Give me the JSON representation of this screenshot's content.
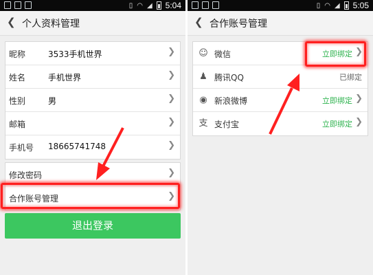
{
  "left_screen": {
    "status": {
      "time": "5:04"
    },
    "title": "个人资料管理",
    "profile_rows": [
      {
        "label": "昵称",
        "value": "3533手机世界"
      },
      {
        "label": "姓名",
        "value": "手机世界"
      },
      {
        "label": "性别",
        "value": "男"
      },
      {
        "label": "邮箱",
        "value": ""
      },
      {
        "label": "手机号",
        "value": "18665741748"
      }
    ],
    "settings_rows": [
      {
        "label": "修改密码"
      },
      {
        "label": "合作账号管理"
      }
    ],
    "logout_label": "退出登录"
  },
  "right_screen": {
    "status": {
      "time": "5:05"
    },
    "title": "合作账号管理",
    "accounts": [
      {
        "icon": "wechat-icon",
        "name": "微信",
        "action": "立即绑定",
        "bound": false
      },
      {
        "icon": "qq-icon",
        "name": "腾讯QQ",
        "action": "已绑定",
        "bound": true
      },
      {
        "icon": "weibo-icon",
        "name": "新浪微博",
        "action": "立即绑定",
        "bound": false
      },
      {
        "icon": "alipay-icon",
        "name": "支付宝",
        "action": "立即绑定",
        "bound": false
      }
    ]
  },
  "icons": {
    "back": "back-chevron-icon",
    "row_chevron": "chevron-right-icon"
  },
  "colors": {
    "accent_green": "#3cc760",
    "bind_text": "#2fb34f",
    "highlight_red": "#ff1f1f"
  }
}
